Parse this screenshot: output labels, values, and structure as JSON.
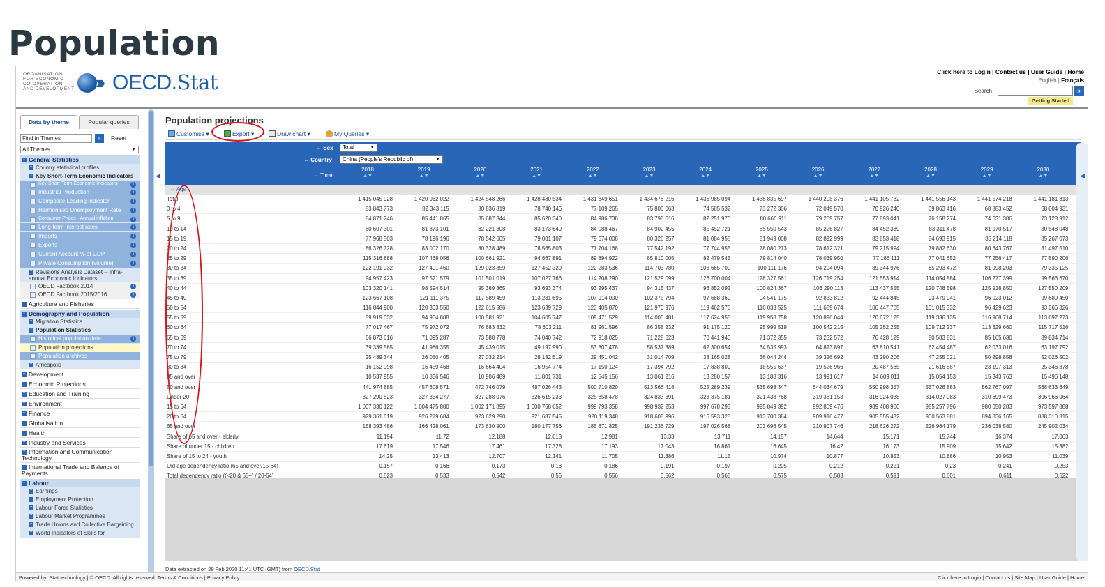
{
  "page_title": "Population",
  "oecd": {
    "org_name": "ORGANISATION\nFOR ECONOMIC\nCO-OPERATION\nAND DEVELOPMENT",
    "brand_main": "OECD.",
    "brand_stat": "Stat",
    "toplinks": "Click here to Login | Contact us | User Guide | Home",
    "lang_en": "English",
    "lang_sep": " | ",
    "lang_fr": "Français",
    "search_label": "Search",
    "search_go": "»",
    "getting_started": "Getting Started"
  },
  "sidebar": {
    "tab_theme": "Data by theme",
    "tab_popular": "Popular queries",
    "find_placeholder": "Find in Themes",
    "find_go": "»",
    "reset": "Reset",
    "theme_select": "All Themes",
    "items": [
      {
        "label": "General Statistics",
        "type": "lvl0b",
        "ex": "-"
      },
      {
        "label": "Country statistical profiles",
        "type": "lvl1",
        "ex": "+"
      },
      {
        "label": "Key Short-Term Economic Indicators",
        "type": "lvl1b",
        "ex": "-"
      },
      {
        "label": "Key Short-Term Economic Indicators",
        "type": "lvl2",
        "info": true
      },
      {
        "label": "Industrial Production",
        "type": "lvl2",
        "info": true
      },
      {
        "label": "Composite Leading Indicator",
        "type": "lvl2",
        "info": true
      },
      {
        "label": "Harmonised Unemployment Rate",
        "type": "lvl2",
        "info": true
      },
      {
        "label": "Consumer Prices - Annual inflation",
        "type": "lvl2",
        "info": true
      },
      {
        "label": "Long-term interest rates",
        "type": "lvl2",
        "info": true
      },
      {
        "label": "Imports",
        "type": "lvl2",
        "info": true
      },
      {
        "label": "Exports",
        "type": "lvl2",
        "info": true
      },
      {
        "label": "Current Account % of GDP",
        "type": "lvl2",
        "info": true
      },
      {
        "label": "Private Consumption (volume)",
        "type": "lvl2",
        "info": true
      },
      {
        "label": "Revisions Analysis Dataset -- Infra-annual Economic Indicators",
        "type": "lvl1",
        "ex": "+"
      },
      {
        "label": "OECD Factbook 2014",
        "type": "lvl2w",
        "info": true
      },
      {
        "label": "OECD Factbook 2015/2016",
        "type": "lvl2w",
        "info": true
      },
      {
        "label": "Agriculture and Fisheries",
        "type": "lvl0",
        "ex": "+"
      },
      {
        "label": "Demography and Population",
        "type": "lvl0b",
        "ex": "-"
      },
      {
        "label": "Migration Statistics",
        "type": "lvl1",
        "ex": "+"
      },
      {
        "label": "Population Statistics",
        "type": "lvl1b",
        "ex": "-"
      },
      {
        "label": "Historical population data",
        "type": "lvl2",
        "info": true
      },
      {
        "label": "Population projections",
        "type": "lvl2y"
      },
      {
        "label": "Population archives",
        "type": "lvl2"
      },
      {
        "label": "Africapolis",
        "type": "lvl1",
        "ex": "+"
      },
      {
        "label": "Development",
        "type": "lvl0",
        "ex": "+"
      },
      {
        "label": "Economic Projections",
        "type": "lvl0",
        "ex": "+"
      },
      {
        "label": "Education and Training",
        "type": "lvl0",
        "ex": "+"
      },
      {
        "label": "Environment",
        "type": "lvl0",
        "ex": "+"
      },
      {
        "label": "Finance",
        "type": "lvl0",
        "ex": "+"
      },
      {
        "label": "Globalisation",
        "type": "lvl0",
        "ex": "+"
      },
      {
        "label": "Health",
        "type": "lvl0",
        "ex": "+"
      },
      {
        "label": "Industry and Services",
        "type": "lvl0",
        "ex": "+"
      },
      {
        "label": "Information and Communication Technology",
        "type": "lvl0",
        "ex": "+"
      },
      {
        "label": "International Trade and Balance of Payments",
        "type": "lvl0",
        "ex": "+"
      },
      {
        "label": "Labour",
        "type": "lvl0b",
        "ex": "-"
      },
      {
        "label": "Earnings",
        "type": "lvl1",
        "ex": "+"
      },
      {
        "label": "Employment Protection",
        "type": "lvl1",
        "ex": "+"
      },
      {
        "label": "Labour Force Statistics",
        "type": "lvl1",
        "ex": "+"
      },
      {
        "label": "Labour Market Programmes",
        "type": "lvl1",
        "ex": "+"
      },
      {
        "label": "Trade Unions and Collective Bargaining",
        "type": "lvl1",
        "ex": "+"
      },
      {
        "label": "World Indicators of Skills for",
        "type": "lvl1",
        "ex": "+"
      }
    ]
  },
  "main": {
    "title": "Population projections",
    "toolbar": {
      "customise": "Customise",
      "export": "Export",
      "draw_chart": "Draw chart",
      "my_queries": "My Queries"
    },
    "dims": {
      "sex_label": "Sex",
      "sex_value": "Total",
      "country_label": "Country",
      "country_value": "China (People's Republic of)",
      "time_label": "Time",
      "age_label": "Age"
    },
    "years": [
      "2018",
      "2019",
      "2020",
      "2021",
      "2022",
      "2023",
      "2024",
      "2025",
      "2026",
      "2027",
      "2028",
      "2029",
      "2030"
    ],
    "sort_arrows": "▲▼",
    "rows": [
      {
        "label": "Total",
        "values": [
          "1 415 045 928",
          "1 420 062 022",
          "1 424 548 266",
          "1 428 480 534",
          "1 431 849 651",
          "1 434 676 216",
          "1 436 985 094",
          "1 438 835 697",
          "1 440 205 376",
          "1 441 105 782",
          "1 441 556 143",
          "1 441 574 218",
          "1 441 181 813"
        ]
      },
      {
        "label": "0 to 4",
        "values": [
          "83 843 773",
          "82 343 115",
          "80 836 819",
          "78 740 146",
          "77 109 265",
          "75 806 063",
          "74 585 532",
          "73 272 306",
          "72 049 570",
          "70 926 240",
          "69 863 416",
          "68 883 452",
          "68 004 931"
        ]
      },
      {
        "label": "5 to 9",
        "values": [
          "84 871 246",
          "85 441 865",
          "85 687 344",
          "85 620 340",
          "84 986 738",
          "83 798 616",
          "82 251 970",
          "80 666 911",
          "79 209 757",
          "77 893 041",
          "76 158 274",
          "74 631 386",
          "73 128 912"
        ]
      },
      {
        "label": "10 to 14",
        "values": [
          "80 607 301",
          "81 373 101",
          "82 221 308",
          "83 173 640",
          "84 088 467",
          "84 902 455",
          "85 452 721",
          "85 550 543",
          "85 226 827",
          "84 452 339",
          "83 311 478",
          "81 970 517",
          "80 548 048"
        ]
      },
      {
        "label": "15 to 19",
        "values": [
          "77 968 503",
          "78 196 196",
          "78 542 605",
          "79 081 107",
          "79 674 008",
          "80 326 257",
          "81 084 958",
          "81 949 008",
          "82 892 999",
          "83 853 418",
          "84 693 915",
          "85 214 118",
          "85 267 073"
        ]
      },
      {
        "label": "20 to 24",
        "values": [
          "86 326 728",
          "83 002 170",
          "80 328 489",
          "78 565 803",
          "77 704 168",
          "77 542 192",
          "77 744 955",
          "78 080 273",
          "78 612 321",
          "79 215 994",
          "79 882 630",
          "80 643 767",
          "81 497 510"
        ]
      },
      {
        "label": "25 to 29",
        "values": [
          "115 316 888",
          "107 468 056",
          "100 661 921",
          "94 867 891",
          "89 894 922",
          "85 810 005",
          "82 479 545",
          "79 814 040",
          "78 039 950",
          "77 186 111",
          "77 041 652",
          "77 256 417",
          "77 590 206"
        ]
      },
      {
        "label": "30 to 34",
        "values": [
          "122 191 932",
          "127 401 460",
          "129 023 359",
          "127 452 329",
          "122 283 536",
          "114 703 780",
          "106 665 709",
          "100 111 176",
          "94 294 094",
          "89 344 976",
          "85 293 472",
          "81 998 203",
          "79 335 125"
        ]
      },
      {
        "label": "35 to 39",
        "values": [
          "94 957 423",
          "97 521 579",
          "101 501 019",
          "107 027 766",
          "114 208 290",
          "121 529 099",
          "126 700 004",
          "128 327 561",
          "126 719 254",
          "121 553 914",
          "114 054 884",
          "106 277 399",
          "99 566 670"
        ]
      },
      {
        "label": "40 to 44",
        "values": [
          "103 320 141",
          "98 594 514",
          "95 389 865",
          "93 693 374",
          "93 295 437",
          "94 315 437",
          "96 852 092",
          "100 824 367",
          "106 290 113",
          "113 437 555",
          "120 748 598",
          "125 918 850",
          "127 550 209"
        ]
      },
      {
        "label": "45 to 49",
        "values": [
          "123 667 108",
          "121 111 375",
          "117 589 459",
          "113 231 695",
          "107 914 000",
          "102 375 794",
          "97 688 369",
          "94 541 175",
          "92 833 812",
          "92 444 845",
          "93 479 941",
          "96 023 012",
          "99 689 450"
        ]
      },
      {
        "label": "50 to 54",
        "values": [
          "116 844 900",
          "120 303 550",
          "122 615 586",
          "123 639 729",
          "123 405 870",
          "121 970 976",
          "119 462 576",
          "116 033 525",
          "111 689 674",
          "106 447 705",
          "101 015 332",
          "96 429 623",
          "93 366 326"
        ]
      },
      {
        "label": "55 to 59",
        "values": [
          "89 919 032",
          "94 904 888",
          "100 581 921",
          "104 605 747",
          "109 471 529",
          "114 000 481",
          "117 624 955",
          "119 958 758",
          "120 896 044",
          "120 672 125",
          "119 336 135",
          "116 968 714",
          "113 697 273"
        ]
      },
      {
        "label": "60 to 64",
        "values": [
          "77 017 467",
          "75 972 072",
          "76 683 832",
          "78 603 211",
          "81 961 596",
          "86 358 232",
          "91 175 120",
          "95 999 519",
          "100 542 215",
          "105 252 255",
          "109 712 237",
          "113 329 660",
          "115 717 516"
        ]
      },
      {
        "label": "65 to 69",
        "values": [
          "66 873 616",
          "71 095 287",
          "73 588 778",
          "74 040 742",
          "72 918 025",
          "71 228 623",
          "70 441 940",
          "71 372 355",
          "73 232 572",
          "76 428 129",
          "80 583 831",
          "85 165 630",
          "89 834 714"
        ]
      },
      {
        "label": "70 to 74",
        "values": [
          "39 339 585",
          "41 986 355",
          "45 439 015",
          "49 197 990",
          "53 807 478",
          "58 537 389",
          "62 300 654",
          "64 535 993",
          "64 823 897",
          "63 810 541",
          "62 454 487",
          "62 033 016",
          "63 197 792"
        ]
      },
      {
        "label": "75 to 79",
        "values": [
          "25 489 344",
          "26 050 405",
          "27 032 214",
          "28 182 519",
          "29 451 042",
          "31 014 709",
          "33 165 028",
          "36 044 244",
          "39 326 692",
          "43 290 206",
          "47 255 021",
          "50 298 858",
          "52 026 502"
        ]
      },
      {
        "label": "80 to 84",
        "values": [
          "16 152 998",
          "16 459 468",
          "16 664 404",
          "16 954 774",
          "17 150 124",
          "17 394 792",
          "17 838 809",
          "18 555 637",
          "19 526 966",
          "20 487 585",
          "21 616 887",
          "23 197 313",
          "25 346 878"
        ]
      },
      {
        "label": "85 and over",
        "values": [
          "10 537 955",
          "10 836 546",
          "10 906 489",
          "11 801 731",
          "12 545 156",
          "13 061 216",
          "13 280 157",
          "13 188 316",
          "13 991 617",
          "14 609 811",
          "15 054 153",
          "15 343 763",
          "15 496 148"
        ]
      },
      {
        "label": "50 and over",
        "values": [
          "441 974 885",
          "457 608 571",
          "472 746 079",
          "487 026 443",
          "500 710 820",
          "513 566 418",
          "525 289 239",
          "535 698 347",
          "544 034 679",
          "550 998 357",
          "557 026 883",
          "562 767 097",
          "568 633 649"
        ]
      },
      {
        "label": "Under 20",
        "values": [
          "327 290 823",
          "327 354 277",
          "327 288 076",
          "326 615 233",
          "325 858 478",
          "324 833 391",
          "323 375 181",
          "321 438 768",
          "319 381 153",
          "316 924 038",
          "314 027 083",
          "310 699 473",
          "306 966 964"
        ]
      },
      {
        "label": "15 to 64",
        "values": [
          "1 007 330 122",
          "1 004 475 880",
          "1 002 171 895",
          "1 000 768 652",
          "999 793 358",
          "998 932 253",
          "997 678 293",
          "995 849 392",
          "992 809 476",
          "989 408 900",
          "985 257 796",
          "980 050 283",
          "973 597 888"
        ]
      },
      {
        "label": "20 to 64",
        "values": [
          "929 361 619",
          "926 279 684",
          "923 629 290",
          "921 687 545",
          "920 119 348",
          "918 605 996",
          "916 593 325",
          "913 700 384",
          "909 916 477",
          "905 555 482",
          "900 563 881",
          "894 836 165",
          "888 310 815"
        ]
      },
      {
        "label": "65 and over",
        "values": [
          "158 393 486",
          "166 428 061",
          "173 630 900",
          "180 177 756",
          "185 871 825",
          "191 236 729",
          "197 026 568",
          "203 696 545",
          "210 907 746",
          "218 626 272",
          "226 964 179",
          "236 038 580",
          "245 902 034"
        ]
      },
      {
        "label": "Share of 65 and over - elderly",
        "values": [
          "11.194",
          "11.72",
          "12.188",
          "12.613",
          "12.981",
          "13.33",
          "13.711",
          "14.157",
          "14.644",
          "15.171",
          "15.744",
          "16.374",
          "17.063"
        ]
      },
      {
        "label": "Share of under 15 - children",
        "values": [
          "17.619",
          "17.546",
          "17.461",
          "17.328",
          "17.193",
          "17.043",
          "16.861",
          "16.645",
          "16.42",
          "16.173",
          "15.909",
          "15.642",
          "15.382"
        ]
      },
      {
        "label": "Share of 15 to 24 - youth",
        "values": [
          "14.25",
          "13.413",
          "12.707",
          "12.141",
          "11.705",
          "11.386",
          "11.15",
          "10.974",
          "10.877",
          "10.853",
          "10.886",
          "10.953",
          "11.039"
        ]
      },
      {
        "label": "Old age dependency ratio (65 and over/15-64)",
        "values": [
          "0.157",
          "0.166",
          "0.173",
          "0.18",
          "0.186",
          "0.191",
          "0.197",
          "0.205",
          "0.212",
          "0.221",
          "0.23",
          "0.241",
          "0.253"
        ]
      },
      {
        "label": "Total dependency ratio ((<20 & 65+) / 20-64)",
        "values": [
          "0.523",
          "0.533",
          "0.542",
          "0.55",
          "0.556",
          "0.562",
          "0.568",
          "0.575",
          "0.583",
          "0.591",
          "0.601",
          "0.611",
          "0.622"
        ]
      }
    ],
    "extracted_prefix": "Data extracted on 29 Feb 2020 11:41 UTC (GMT) from ",
    "extracted_link": "OECD.Stat"
  },
  "footer": {
    "left": "Powered by .Stat technology | © OECD. All rights reserved. Terms & Conditions | Privacy Policy",
    "right": "Click here to Login | Contact us | Site Map | User Guide | Home"
  },
  "colors": {
    "accent": "#2a66b8",
    "highlight_oval": "#d8141c",
    "title": "#2b3a42"
  }
}
